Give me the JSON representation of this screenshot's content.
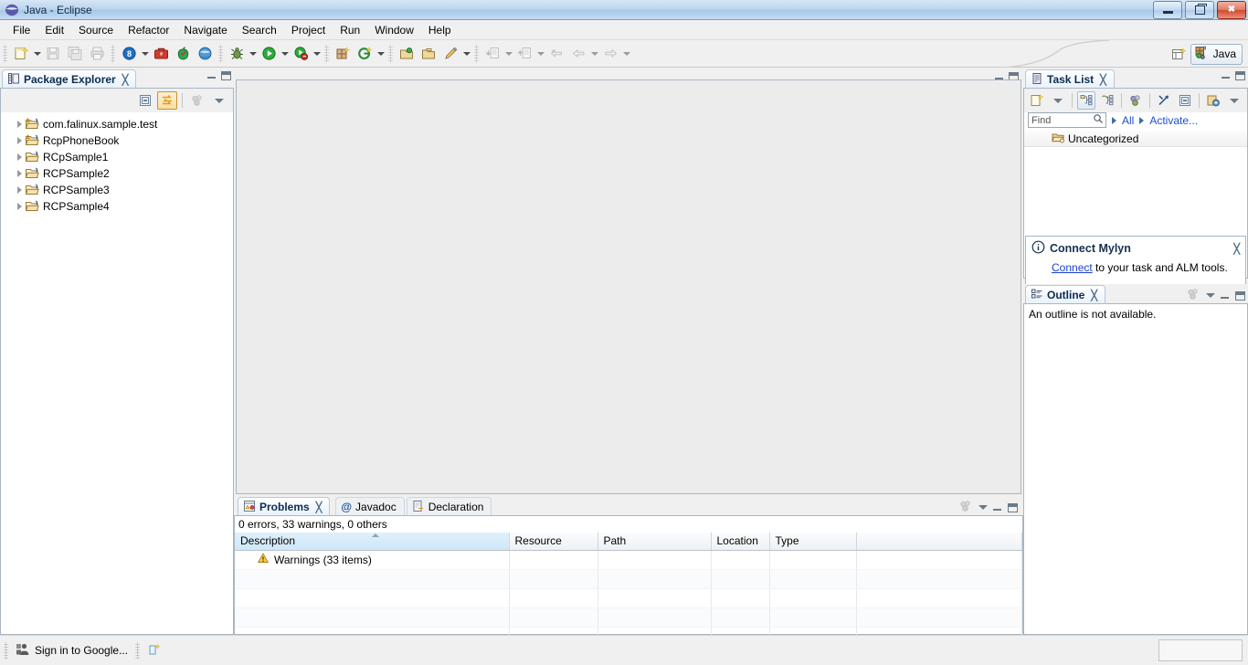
{
  "window": {
    "title": "Java - Eclipse",
    "icon": "eclipse-icon",
    "buttons": {
      "minimize": "minimize-button",
      "restore": "restore-button",
      "close": "close-button"
    }
  },
  "menubar": {
    "items": [
      {
        "label": "File"
      },
      {
        "label": "Edit"
      },
      {
        "label": "Source"
      },
      {
        "label": "Refactor"
      },
      {
        "label": "Navigate"
      },
      {
        "label": "Search"
      },
      {
        "label": "Project"
      },
      {
        "label": "Run"
      },
      {
        "label": "Window"
      },
      {
        "label": "Help"
      }
    ]
  },
  "toolbar": {
    "groups": [
      {
        "buttons": [
          {
            "icon": "new-wizard-icon",
            "dropdown": true,
            "enabled": true
          },
          {
            "icon": "save-icon",
            "dropdown": false,
            "enabled": false
          },
          {
            "icon": "save-all-icon",
            "dropdown": false,
            "enabled": false
          },
          {
            "icon": "print-icon",
            "dropdown": false,
            "enabled": false
          }
        ]
      },
      {
        "buttons": [
          {
            "icon": "open-type-icon",
            "dropdown": true,
            "enabled": true
          },
          {
            "icon": "toolbox-icon",
            "dropdown": false,
            "enabled": true
          },
          {
            "icon": "apple-debug-icon",
            "dropdown": false,
            "enabled": true
          },
          {
            "icon": "globe-run-icon",
            "dropdown": false,
            "enabled": true
          }
        ]
      },
      {
        "buttons": [
          {
            "icon": "debug-icon",
            "dropdown": true,
            "enabled": true
          },
          {
            "icon": "run-icon",
            "dropdown": true,
            "enabled": true
          },
          {
            "icon": "external-tools-icon",
            "dropdown": true,
            "enabled": true
          }
        ]
      },
      {
        "buttons": [
          {
            "icon": "new-java-package-icon",
            "dropdown": false,
            "enabled": true
          },
          {
            "icon": "new-java-class-icon",
            "dropdown": true,
            "enabled": true
          }
        ]
      },
      {
        "buttons": [
          {
            "icon": "open-task-icon",
            "dropdown": false,
            "enabled": true
          },
          {
            "icon": "open-folder-icon",
            "dropdown": false,
            "enabled": true
          },
          {
            "icon": "pencil-annotate-icon",
            "dropdown": true,
            "enabled": true
          }
        ]
      },
      {
        "buttons": [
          {
            "icon": "previous-annotation-icon",
            "dropdown": true,
            "enabled": false
          },
          {
            "icon": "next-annotation-icon",
            "dropdown": true,
            "enabled": false
          },
          {
            "icon": "last-edit-location-icon",
            "dropdown": false,
            "enabled": false
          },
          {
            "icon": "back-icon",
            "dropdown": true,
            "enabled": false
          },
          {
            "icon": "forward-icon",
            "dropdown": true,
            "enabled": false
          }
        ]
      }
    ],
    "perspective": {
      "open_perspective_icon": "open-perspective-icon",
      "active_label": "Java",
      "active_icon": "java-perspective-icon"
    }
  },
  "package_explorer": {
    "tab_label": "Package Explorer",
    "close_icon": "close-tab-icon",
    "toolbar": [
      {
        "name": "collapse-all-button",
        "icon": "collapse-all-icon",
        "state": "normal"
      },
      {
        "name": "link-with-editor-button",
        "icon": "link-with-editor-icon",
        "state": "pressed"
      },
      {
        "name": "view-menu-button",
        "icon": "view-menu-icon",
        "state": "disabled"
      },
      {
        "name": "view-menu-arrow",
        "icon": "chevron-down-icon",
        "state": "normal"
      }
    ],
    "tree": [
      {
        "label": "com.falinux.sample.test",
        "icon": "java-project-warning-icon",
        "expandable": true
      },
      {
        "label": "RcpPhoneBook",
        "icon": "java-project-warning-icon",
        "expandable": true
      },
      {
        "label": "RCpSample1",
        "icon": "java-project-icon",
        "expandable": true
      },
      {
        "label": "RCPSample2",
        "icon": "java-project-icon",
        "expandable": true
      },
      {
        "label": "RCPSample3",
        "icon": "java-project-icon",
        "expandable": true
      },
      {
        "label": "RCPSample4",
        "icon": "java-project-icon",
        "expandable": true
      }
    ]
  },
  "editor_area": {
    "empty": true
  },
  "task_list": {
    "tab_label": "Task List",
    "close_icon": "close-tab-icon",
    "toolbar": [
      {
        "name": "new-task-button",
        "icon": "new-task-icon",
        "state": "normal"
      },
      {
        "name": "new-task-dropdown",
        "icon": "chevron-down-icon",
        "state": "normal"
      },
      {
        "name": "categorized-presentation-button",
        "icon": "categorized-icon",
        "state": "toggled"
      },
      {
        "name": "scheduled-presentation-button",
        "icon": "scheduled-icon",
        "state": "normal"
      },
      {
        "name": "focus-on-workweek-button",
        "icon": "focus-icon",
        "state": "disabled"
      },
      {
        "name": "synchronize-button",
        "icon": "synchronize-icon",
        "state": "normal"
      },
      {
        "name": "collapse-all-button",
        "icon": "collapse-all-icon",
        "state": "normal"
      },
      {
        "name": "restore-tasks-button",
        "icon": "restore-tasks-icon",
        "state": "normal"
      },
      {
        "name": "view-menu-button",
        "icon": "chevron-down-icon",
        "state": "normal"
      }
    ],
    "find": {
      "placeholder": "Find",
      "value": "",
      "icon": "search-icon"
    },
    "filter_all_label": "All",
    "activate_label": "Activate...",
    "categories": [
      {
        "label": "Uncategorized",
        "icon": "category-folder-icon"
      }
    ]
  },
  "mylyn_notice": {
    "icon": "info-icon",
    "title": "Connect Mylyn",
    "link_text": "Connect",
    "body_text": " to your task and ALM tools.",
    "close_icon": "close-icon"
  },
  "outline": {
    "tab_label": "Outline",
    "close_icon": "close-tab-icon",
    "toolbar": [
      {
        "name": "focus-button",
        "icon": "focus-icon",
        "state": "disabled"
      },
      {
        "name": "view-menu-button",
        "icon": "chevron-down-icon",
        "state": "normal"
      }
    ],
    "message": "An outline is not available."
  },
  "problems": {
    "tabs": [
      {
        "label": "Problems",
        "icon": "problems-icon",
        "active": true,
        "closeable": true
      },
      {
        "label": "Javadoc",
        "icon": "javadoc-icon",
        "active": false,
        "closeable": false
      },
      {
        "label": "Declaration",
        "icon": "declaration-icon",
        "active": false,
        "closeable": false
      }
    ],
    "summary": "0 errors, 33 warnings, 0 others",
    "columns": [
      {
        "label": "Description",
        "sorted": true,
        "sort_dir": "asc"
      },
      {
        "label": "Resource",
        "sorted": false
      },
      {
        "label": "Path",
        "sorted": false
      },
      {
        "label": "Location",
        "sorted": false
      },
      {
        "label": "Type",
        "sorted": false
      }
    ],
    "rows": [
      {
        "icon": "warning-icon",
        "description": "Warnings (33 items)",
        "resource": "",
        "path": "",
        "location": "",
        "type": ""
      },
      {
        "icon": "",
        "description": "",
        "resource": "",
        "path": "",
        "location": "",
        "type": ""
      },
      {
        "icon": "",
        "description": "",
        "resource": "",
        "path": "",
        "location": "",
        "type": ""
      },
      {
        "icon": "",
        "description": "",
        "resource": "",
        "path": "",
        "location": "",
        "type": ""
      },
      {
        "icon": "",
        "description": "",
        "resource": "",
        "path": "",
        "location": "",
        "type": ""
      }
    ],
    "view_toolbar": [
      {
        "name": "focus-button",
        "icon": "focus-icon",
        "state": "disabled"
      },
      {
        "name": "view-menu-button",
        "icon": "chevron-down-icon",
        "state": "normal"
      },
      {
        "name": "minimize-button",
        "icon": "minimize-icon",
        "state": "normal"
      },
      {
        "name": "maximize-button",
        "icon": "maximize-icon",
        "state": "normal"
      }
    ]
  },
  "statusbar": {
    "google_signin_label": "Sign in to Google...",
    "google_icon": "google-user-icon",
    "extra_icon": "new-element-icon"
  },
  "colors": {
    "accent": "#1a4fd0",
    "warning": "#f0a30a",
    "title_gradient_start": "#d6e6f5",
    "title_gradient_end": "#a8c9e8",
    "tab_active": "#ffffff",
    "panel_bg": "#f0f0f0",
    "close_button": "#cf4a2c"
  }
}
